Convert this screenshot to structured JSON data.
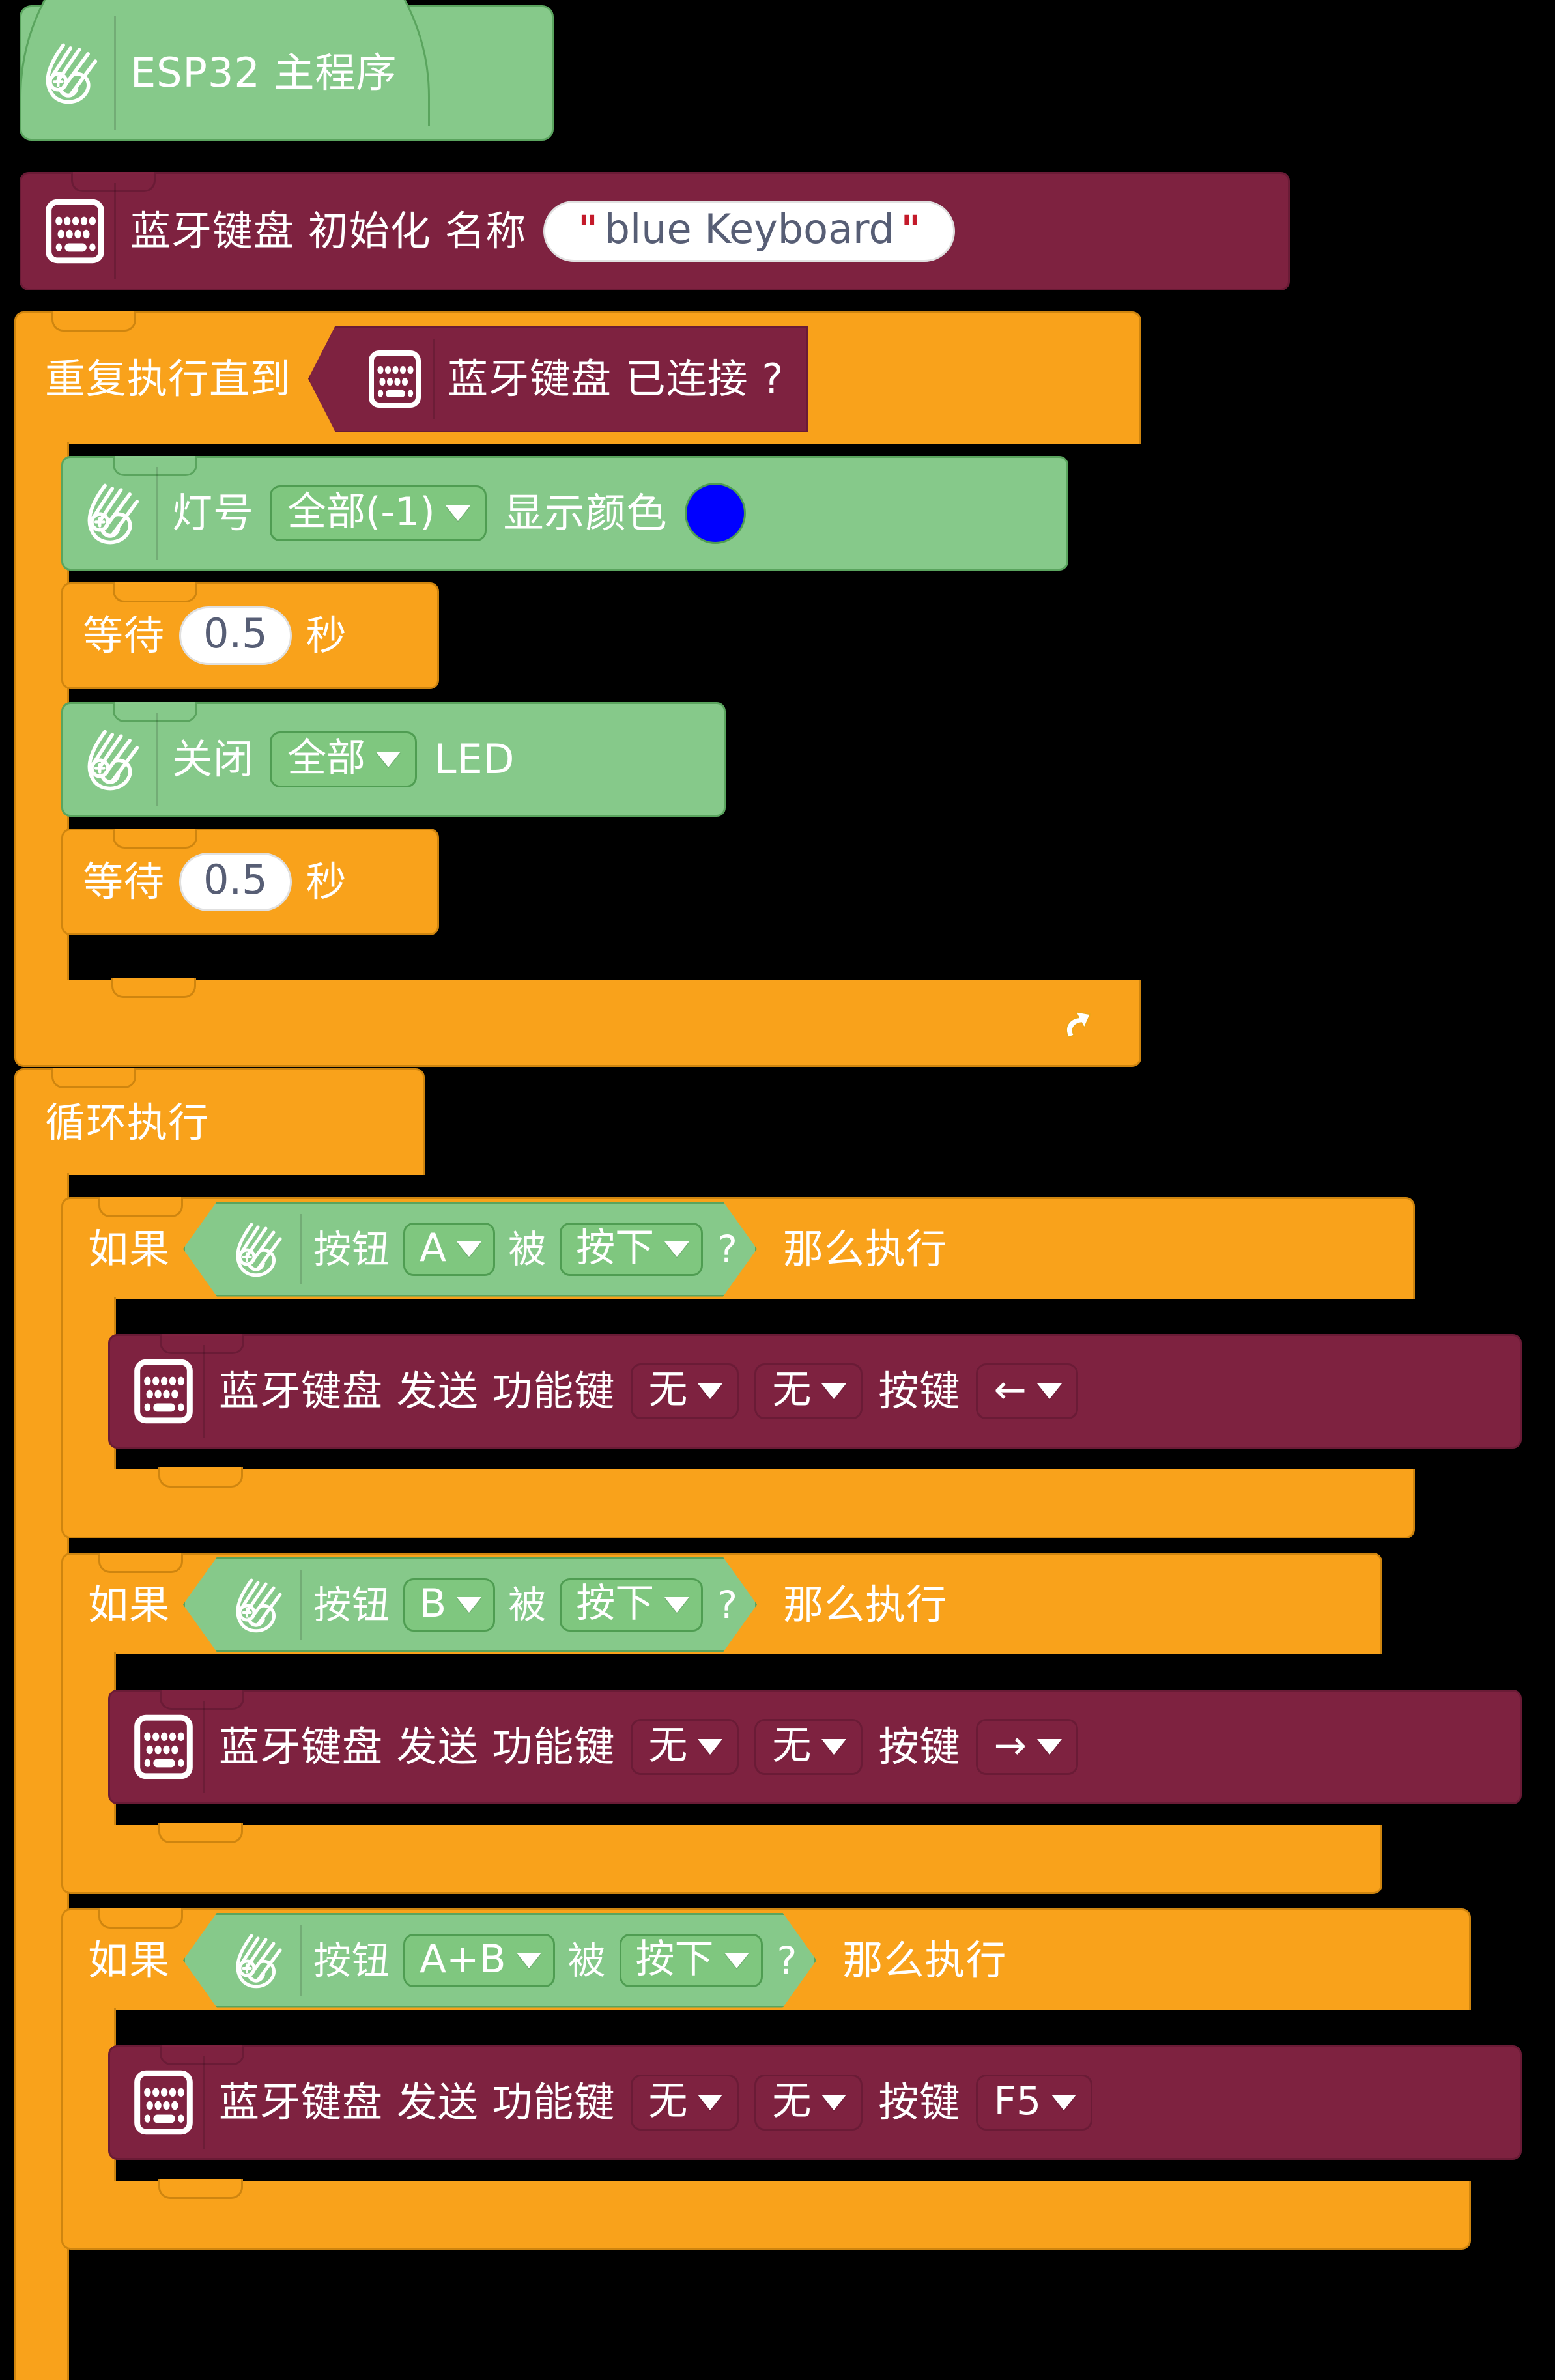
{
  "workspace": {
    "background": "#000000",
    "colors": {
      "green_block": "#86c98a",
      "green_border": "#5aa45e",
      "maroon_block": "#7e2240",
      "maroon_border": "#6a1b36",
      "orange_block": "#f9a21b",
      "orange_border": "#cf850f",
      "led_color_value": "#0000ff",
      "field_text": "#575e75",
      "quote_mark": "#c41a2a"
    }
  },
  "hat_block": {
    "label": "ESP32 主程序",
    "icon": "mbuild-leaf-icon"
  },
  "bt_init": {
    "icon": "keyboard-icon",
    "label_1": "蓝牙键盘 初始化 名称",
    "name_value": "blue Keyboard",
    "quote_open": "\"",
    "quote_close": "\""
  },
  "repeat_until": {
    "label": "重复执行直到",
    "condition": {
      "icon": "keyboard-icon",
      "label": "蓝牙键盘 已连接 ?"
    },
    "loop_arrow_icon": "loop-back-arrow-icon",
    "body": [
      {
        "type": "led-show-color",
        "icon": "mbuild-leaf-icon",
        "label_1": "灯号",
        "dropdown_1": "全部(-1)",
        "label_2": "显示颜色",
        "color_value": "#0000ff"
      },
      {
        "type": "wait",
        "label_1": "等待",
        "value": "0.5",
        "label_2": "秒"
      },
      {
        "type": "led-off",
        "icon": "mbuild-leaf-icon",
        "label_1": "关闭",
        "dropdown_1": "全部",
        "label_2": "LED"
      },
      {
        "type": "wait",
        "label_1": "等待",
        "value": "0.5",
        "label_2": "秒"
      }
    ]
  },
  "forever": {
    "label": "循环执行",
    "branches": [
      {
        "if_label": "如果",
        "then_label": "那么执行",
        "condition": {
          "icon": "mbuild-leaf-icon",
          "label_1": "按钮",
          "dropdown_button": "A",
          "label_2": "被",
          "dropdown_state": "按下",
          "label_3": "?"
        },
        "action": {
          "icon": "keyboard-icon",
          "label_1": "蓝牙键盘 发送 功能键",
          "dropdown_mod1": "无",
          "dropdown_mod2": "无",
          "label_2": "按键",
          "dropdown_key": "←"
        }
      },
      {
        "if_label": "如果",
        "then_label": "那么执行",
        "condition": {
          "icon": "mbuild-leaf-icon",
          "label_1": "按钮",
          "dropdown_button": "B",
          "label_2": "被",
          "dropdown_state": "按下",
          "label_3": "?"
        },
        "action": {
          "icon": "keyboard-icon",
          "label_1": "蓝牙键盘 发送 功能键",
          "dropdown_mod1": "无",
          "dropdown_mod2": "无",
          "label_2": "按键",
          "dropdown_key": "→"
        }
      },
      {
        "if_label": "如果",
        "then_label": "那么执行",
        "condition": {
          "icon": "mbuild-leaf-icon",
          "label_1": "按钮",
          "dropdown_button": "A+B",
          "label_2": "被",
          "dropdown_state": "按下",
          "label_3": "?"
        },
        "action": {
          "icon": "keyboard-icon",
          "label_1": "蓝牙键盘 发送 功能键",
          "dropdown_mod1": "无",
          "dropdown_mod2": "无",
          "label_2": "按键",
          "dropdown_key": "F5"
        }
      }
    ]
  }
}
